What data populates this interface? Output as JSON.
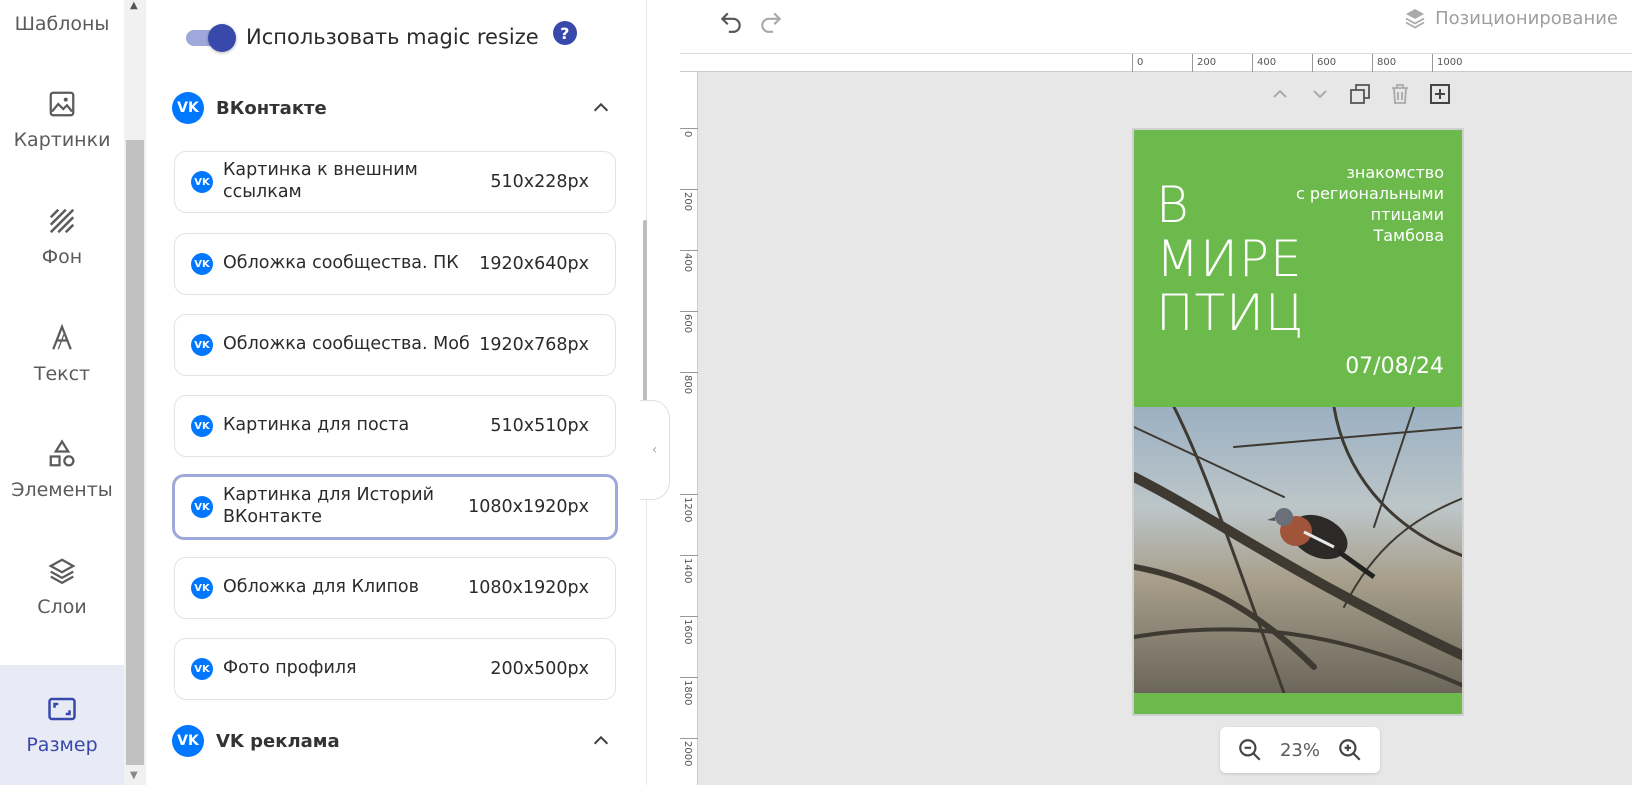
{
  "nav": {
    "items": [
      {
        "label": "Шаблоны",
        "icon": "templates-icon"
      },
      {
        "label": "Картинки",
        "icon": "image-icon"
      },
      {
        "label": "Фон",
        "icon": "background-icon"
      },
      {
        "label": "Текст",
        "icon": "text-icon"
      },
      {
        "label": "Элементы",
        "icon": "shapes-icon"
      },
      {
        "label": "Слои",
        "icon": "layers-icon"
      },
      {
        "label": "Размер",
        "icon": "resize-icon"
      }
    ],
    "active": "Размер"
  },
  "panel": {
    "magic_resize_label": "Использовать magic resize",
    "magic_resize_on": true,
    "help_glyph": "?",
    "groups": [
      {
        "title": "ВКонтакте",
        "logo": "VK",
        "expanded": true,
        "items": [
          {
            "name": "Картинка к внешним ссылкам",
            "size": "510x228px"
          },
          {
            "name": "Обложка сообщества. ПК",
            "size": "1920x640px"
          },
          {
            "name": "Обложка сообщества. Моб",
            "size": "1920x768px"
          },
          {
            "name": "Картинка для поста",
            "size": "510x510px"
          },
          {
            "name": "Картинка для Историй ВКонтакте",
            "size": "1080x1920px",
            "selected": true
          },
          {
            "name": "Обложка для Клипов",
            "size": "1080x1920px"
          },
          {
            "name": "Фото профиля",
            "size": "200x500px"
          }
        ]
      },
      {
        "title": "VK реклама",
        "logo": "VK",
        "expanded": true
      }
    ]
  },
  "editor": {
    "toolbar": {
      "undo": "undo-icon",
      "redo": "redo-icon",
      "positioning_label": "Позиционирование"
    },
    "ruler_top": [
      "0",
      "200",
      "400",
      "600",
      "800",
      "1000"
    ],
    "ruler_left": [
      "0",
      "200",
      "400",
      "600",
      "800",
      "1200",
      "1400",
      "1600",
      "1800",
      "2000"
    ],
    "canvas": {
      "background": "#6cba4c",
      "title_lines": [
        "В",
        "МИРЕ",
        "ПТИЦ"
      ],
      "subtitle_lines": [
        "знакомство",
        "с региональными",
        "птицами",
        "Тамбова"
      ],
      "date": "07/08/24"
    },
    "zoom": "23%"
  },
  "colors": {
    "accent": "#3949ab",
    "vk": "#0077ff",
    "canvas_green": "#6cba4c"
  }
}
